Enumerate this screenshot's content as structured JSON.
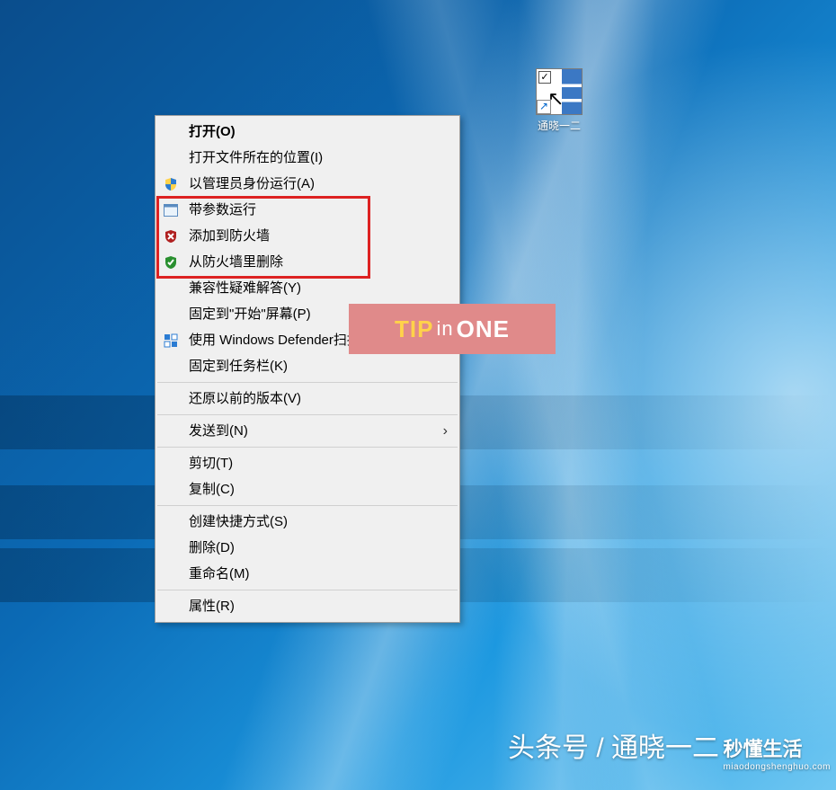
{
  "desktop_icon": {
    "label": "通晓一二"
  },
  "context_menu": {
    "open": "打开(O)",
    "open_location": "打开文件所在的位置(I)",
    "run_as_admin": "以管理员身份运行(A)",
    "run_with_args": "带参数运行",
    "add_firewall": "添加到防火墙",
    "remove_firewall": "从防火墙里删除",
    "compat_troubleshoot": "兼容性疑难解答(Y)",
    "pin_start": "固定到\"开始\"屏幕(P)",
    "defender_scan": "使用 Windows Defender扫描...",
    "pin_taskbar": "固定到任务栏(K)",
    "restore_previous": "还原以前的版本(V)",
    "send_to": "发送到(N)",
    "cut": "剪切(T)",
    "copy": "复制(C)",
    "create_shortcut": "创建快捷方式(S)",
    "delete": "删除(D)",
    "rename": "重命名(M)",
    "properties": "属性(R)"
  },
  "watermark": {
    "center_tip": "TIP",
    "center_in": "in",
    "center_one": "ONE",
    "bottom_text": "头条号 / 通晓一二",
    "corner_title": "秒懂生活",
    "corner_url": "miaodongshenghuo.com"
  }
}
